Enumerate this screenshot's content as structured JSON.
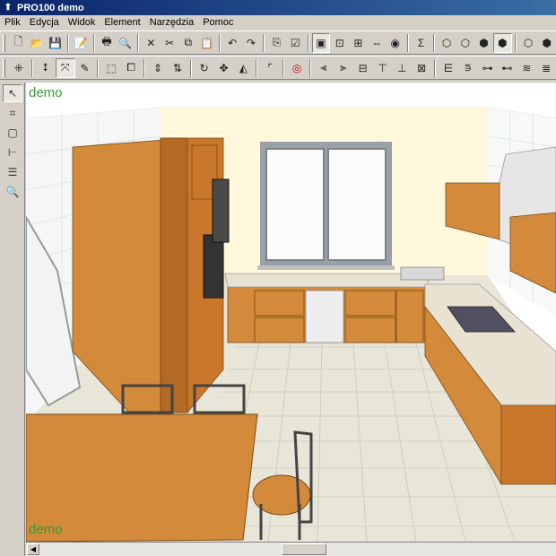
{
  "window": {
    "title": "PRO100 demo"
  },
  "menu": [
    "Plik",
    "Edycja",
    "Widok",
    "Element",
    "Narzędzia",
    "Pomoc"
  ],
  "toolbar1": {
    "icons": [
      "new-file-icon",
      "open-folder-icon",
      "save-icon",
      "export-icon",
      "print-icon",
      "print-preview-icon",
      "cut-icon",
      "copy-icon",
      "copy2-icon",
      "paste-icon",
      "undo-icon",
      "redo-icon",
      "properties-icon",
      "list-icon",
      "view-front-icon",
      "view-zoom-icon",
      "view-top-icon",
      "view-fit-icon",
      "render-icon",
      "sum-icon",
      "box-view-1-icon",
      "box-view-2-icon",
      "box-view-3-icon",
      "box-view-4-icon",
      "box-view-5-icon",
      "box-view-6-icon"
    ],
    "sum_glyph": "Σ"
  },
  "toolbar2": {
    "icons": [
      "grid-select-icon",
      "move-icon",
      "rotate-3d-icon",
      "pencil-icon",
      "frame-icon",
      "frame-alt-icon",
      "move-vertical-icon",
      "move-vertical2-icon",
      "rotate-icon",
      "arrows-move-icon",
      "mirror-icon",
      "corner-icon",
      "target-icon",
      "align-left-icon",
      "align-right-icon",
      "align-center-icon",
      "align-top-icon",
      "align-bottom-icon",
      "align-mid-icon",
      "distribute-icon",
      "distribute-v-icon",
      "spread-icon",
      "spread-v-icon",
      "stack-icon",
      "stack-v-icon"
    ]
  },
  "sidebar": [
    "pointer-icon",
    "wireframe-icon",
    "box-icon",
    "dimension-icon",
    "layers-icon",
    "zoom-icon"
  ],
  "viewport": {
    "watermark": "demo",
    "colors": {
      "wood": "#d38a3a",
      "wood_dark": "#a8641f",
      "wall": "#fff8dc",
      "floor": "#e7e6d8",
      "counter": "#e8e2d2"
    }
  }
}
